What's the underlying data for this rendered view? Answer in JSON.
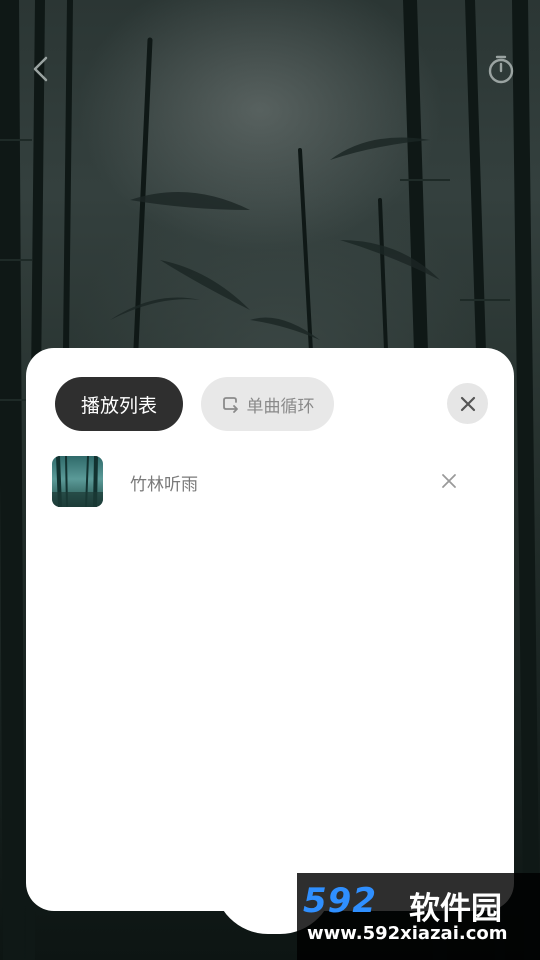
{
  "header": {
    "back_icon": "chevron-left-icon",
    "timer_icon": "stopwatch-icon"
  },
  "playlist_panel": {
    "tabs": {
      "playlist_label": "播放列表",
      "loop_label": "单曲循环",
      "loop_icon": "repeat-icon"
    },
    "close_icon": "close-icon",
    "tracks": [
      {
        "title": "竹林听雨",
        "cover": "bamboo-forest-thumbnail",
        "remove_icon": "remove-icon"
      }
    ]
  },
  "watermark": {
    "logo": "592",
    "name": "软件园",
    "url": "www.592xiazai.com"
  },
  "colors": {
    "active_tab_bg": "#2f2f2f",
    "inactive_tab_bg": "#e8e8e8",
    "watermark_blue": "#2f8fff"
  }
}
